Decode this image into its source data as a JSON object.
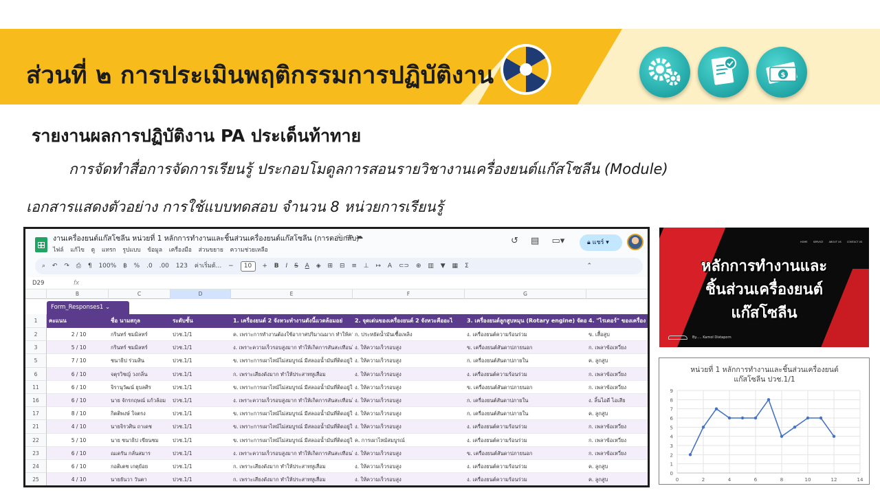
{
  "header": {
    "title": "ส่วนที่ ๒ การประเมินพฤติกรรมการปฏิบัติงาน"
  },
  "report": {
    "heading": "รายงานผลการปฏิบัติงาน PA ประเด็นท้าทาย",
    "subheading": "การจัดทำสื่อการจัดการเรียนรู้ ประกอบโมดูลการสอนรายวิชางานเครื่องยนต์แก๊สโซลีน (Module)",
    "document_caption": "เอกสารแสดงตัวอย่าง การใช้แบบทดสอบ จำนวน 8 หน่วยการเรียนรู้"
  },
  "sheet": {
    "doc_title": "งานเครื่องยนต์แก๊สโซลีน หน่วยที่ 1 หลักการทำงานและชิ้นส่วนเครื่องยนต์แก๊สโซลีน (การตอบกลับ)",
    "menu": [
      "ไฟล์",
      "แก้ไข",
      "ดู",
      "แทรก",
      "รูปแบบ",
      "ข้อมูล",
      "เครื่องมือ",
      "ส่วนขยาย",
      "ความช่วยเหลือ"
    ],
    "share_label": "แชร์",
    "toolbar": {
      "zoom": "100%",
      "currency": "฿",
      "percent": "%",
      "dec_decrease": ".0",
      "dec_increase": ".00",
      "number_format": "123",
      "font": "ค่าเริ่มต้...",
      "font_size": "10",
      "bold": "B",
      "italic": "I",
      "strike": "S",
      "text_color": "A"
    },
    "cell_ref": "D29",
    "fx": "fx",
    "columns": [
      "B",
      "C",
      "D",
      "E",
      "F",
      "G"
    ],
    "tab_name": "Form_Responses1",
    "header_row_num": "1",
    "headers": [
      "คะแนน",
      "ชื่อ นามสกุล",
      "ระดับชั้น",
      "1. เครื่องยนต์ 2 จังหวะทำงานดังนี้แวดล้อมอย่",
      "2. จุดเด่นของเครื่องยนต์ 2 จังหวะคืออะไ",
      "3. เครื่องยนต์ลูกสูบหมุน (Rotary engine) จัดอ",
      "4. \"ไรเดอร์\" ของเครื่อง"
    ],
    "rows": [
      {
        "num": "2",
        "score": "2 / 10",
        "name": "กรินทร์ ชมมิลทร์",
        "level": "ปวช.1/1",
        "q1": "ค. เพราะการทำงานต้องใช้อากาศปริมาณมาก ทำให้ควั",
        "q2": "ก. ประหยัดน้ำมันเชื้อเพลิง",
        "q3": "ง. เครื่องยนต์ความร้อนร่วม",
        "q4": "ข. เสื้อสูบ"
      },
      {
        "num": "3",
        "score": "5 / 10",
        "name": "กรินทร์ ชมมิลทร์",
        "level": "ปวช.1/1",
        "q1": "ง. เพราะความเร็วรอบสูงมาก ทำให้เกิดการสันสะเทือนใ",
        "q2": "ง. ให้ความเร็วรอบสูง",
        "q3": "ข. เครื่องยนต์สันดาปภายนอก",
        "q4": "ก. เพลาข้อเหวี่ยง"
      },
      {
        "num": "5",
        "score": "7 / 10",
        "name": "ชนาธิป ร่วมสิน",
        "level": "ปวช.1/1",
        "q1": "ข. เพราะการเผาไหม้ไม่สมบูรณ์ มีสลออน้ำมันที่ติดอยู่ใน",
        "q2": "ง. ให้ความเร็วรอบสูง",
        "q3": "ก. เครื่องยนต์สันดาปภายใน",
        "q4": "ค. ลูกสูบ"
      },
      {
        "num": "6",
        "score": "6 / 10",
        "name": "จตุรวิชญ์ วงกลิ่น",
        "level": "ปวช.1/1",
        "q1": "ก. เพราะเสียงดังมาก ทำให้ประสาทหูเสื่อม",
        "q2": "ง. ให้ความเร็วรอบสูง",
        "q3": "ง. เครื่องยนต์ความร้อนร่วม",
        "q4": "ก. เพลาข้อเหวี่ยง"
      },
      {
        "num": "11",
        "score": "6 / 10",
        "name": "จิรานุวัฒน์ ยุบลศิร",
        "level": "ปวช.1/1",
        "q1": "ข. เพราะการเผาไหม้ไม่สมบูรณ์ มีสลออน้ำมันที่ติดอยู่ใน",
        "q2": "ง. ให้ความเร็วรอบสูง",
        "q3": "ข. เครื่องยนต์สันดาปภายนอก",
        "q4": "ก. เพลาข้อเหวี่ยง"
      },
      {
        "num": "16",
        "score": "6 / 10",
        "name": "นาย จักรกฤษณ์ แก้วล้อม",
        "level": "ปวช.1/1",
        "q1": "ง. เพราะความเร็วรอบสูงมาก ทำให้เกิดการสันสะเทือนใ",
        "q2": "ง. ให้ความเร็วรอบสูง",
        "q3": "ก. เครื่องยนต์สันดาปภายใน",
        "q4": "ง. ลิ้นไอดี ไอเสีย"
      },
      {
        "num": "17",
        "score": "8 / 10",
        "name": "กิตติพงษ์ ใจตรง",
        "level": "ปวช.1/1",
        "q1": "ข. เพราะการเผาไหม้ไม่สมบูรณ์ มีสลออน้ำมันที่ติดอยู่ใน",
        "q2": "ง. ให้ความเร็วรอบสูง",
        "q3": "ก. เครื่องยนต์สันดาปภายใน",
        "q4": "ค. ลูกสูบ"
      },
      {
        "num": "21",
        "score": "4 / 10",
        "name": "นายจิรวศิน ถาเดช",
        "level": "ปวช.1/1",
        "q1": "ข. เพราะการเผาไหม้ไม่สมบูรณ์ มีสลออน้ำมันที่ติดอยู่ใน",
        "q2": "ง. ให้ความเร็วรอบสูง",
        "q3": "ง. เครื่องยนต์ความร้อนร่วม",
        "q4": "ก. เพลาข้อเหวี่ยง"
      },
      {
        "num": "22",
        "score": "5 / 10",
        "name": "นาย ชนาธิป เขียนชม",
        "level": "ปวช.1/1",
        "q1": "ข. เพราะการเผาไหม้ไม่สมบูรณ์ มีสลออน้ำมันที่ติดอยู่ใน",
        "q2": "ค. การเผาไหม้สมบูรณ์",
        "q3": "ง. เครื่องยนต์ความร้อนร่วม",
        "q4": "ก. เพลาข้อเหวี่ยง"
      },
      {
        "num": "23",
        "score": "6 / 10",
        "name": "ณเดรัน กลั่นสมาร",
        "level": "ปวช.1/1",
        "q1": "ง. เพราะความเร็วรอบสูงมาก ทำให้เกิดการสันสะเทือนใ",
        "q2": "ง. ให้ความเร็วรอบสูง",
        "q3": "ข. เครื่องยนต์สันดาปภายนอก",
        "q4": "ก. เพลาข้อเหวี่ยง"
      },
      {
        "num": "24",
        "score": "6 / 10",
        "name": "กอติเตช เกตุย้อย",
        "level": "ปวช.1/1",
        "q1": "ก. เพราะเสียงดังมาก ทำให้ประสาทหูเสื่อม",
        "q2": "ง. ให้ความเร็วรอบสูง",
        "q3": "ง. เครื่องยนต์ความร้อนร่วม",
        "q4": "ค. ลูกสูบ"
      },
      {
        "num": "25",
        "score": "4 / 10",
        "name": "นายธันวา วันตา",
        "level": "ปวช.1/1",
        "q1": "ก. เพราะเสียงดังมาก ทำให้ประสาทหูเสื่อม",
        "q2": "ง. ให้ความเร็วรอบสูง",
        "q3": "ง. เครื่องยนต์ความร้อนร่วม",
        "q4": "ค. ลูกสูบ"
      }
    ]
  },
  "video": {
    "title_lines": [
      "หลักการทำงานและ",
      "ชิ้นส่วนเครื่องยนต์",
      "แก๊สโซลีน"
    ],
    "nav": [
      "HOME",
      "SERVICE",
      "ABOUT US",
      "CONTACT US"
    ],
    "author": "By..... Kamol Distaporn"
  },
  "chart_data": {
    "type": "line",
    "title": "หน่วยที่ 1 หลักการทำงานและชิ้นส่วนเครื่องยนต์ แก๊สโซลีน ปวช.1/1",
    "title_lines": [
      "หน่วยที่ 1 หลักการทำงานและชิ้นส่วนเครื่องยนต์",
      "แก๊สโซลีน ปวช.1/1"
    ],
    "x": [
      1,
      2,
      3,
      4,
      5,
      6,
      7,
      8,
      9,
      10,
      11,
      12
    ],
    "values": [
      2,
      5,
      7,
      6,
      6,
      6,
      8,
      4,
      5,
      6,
      6,
      4
    ],
    "xlim": [
      0,
      14
    ],
    "ylim": [
      0,
      9
    ],
    "xticks": [
      0,
      2,
      4,
      6,
      8,
      10,
      12,
      14
    ],
    "yticks": [
      0,
      1,
      2,
      3,
      4,
      5,
      6,
      7,
      8,
      9
    ],
    "grid": true,
    "legend": "none",
    "color": "#4472c4"
  },
  "colors": {
    "banner_yellow": "#f7bb1b",
    "banner_light": "#fdf0c4",
    "sheet_header": "#5b3b8c",
    "teal_icon": "#22a7a6"
  }
}
